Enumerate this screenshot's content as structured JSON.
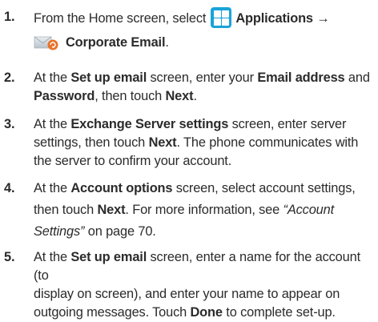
{
  "steps": [
    {
      "num": "1.",
      "t1": "From the Home screen, select",
      "b1": "Applications",
      "arrow": "→",
      "b2": "Corporate Email",
      "t2": "."
    },
    {
      "num": "2.",
      "t1": "At the ",
      "b1": "Set up email",
      "t2": " screen, enter your ",
      "b2": "Email address",
      "t3": " and",
      "b3": "Password",
      "t4": ", then touch ",
      "b4": "Next",
      "t5": "."
    },
    {
      "num": "3.",
      "t1": "At the ",
      "b1": "Exchange Server settings",
      "t2": " screen, enter server",
      "t3": "settings, then touch ",
      "b2": "Next",
      "t4": ". The phone communicates with",
      "t5": "the server to confirm your account."
    },
    {
      "num": "4.",
      "t1": "At the ",
      "b1": "Account options",
      "t2": " screen, select account settings,",
      "t3": "then touch ",
      "b2": "Next",
      "t4": ". For more information, see ",
      "em1": "“Account",
      "em2": "Settings”",
      "t5": " on page 70."
    },
    {
      "num": "5.",
      "t1": "At the ",
      "b1": "Set up email",
      "t2": " screen, enter a name for the account (to",
      "t3": "display on screen), and enter your name to appear on",
      "t4": "outgoing messages. Touch ",
      "b2": "Done",
      "t5": " to complete set-up."
    }
  ],
  "icons": {
    "applications": "applications-icon",
    "corporate_email": "corporate-email-icon"
  },
  "colors": {
    "text": "#2b2b2b",
    "apps_icon_bg": "#19a3d9",
    "email_envelope": "#c8d0d6",
    "email_badge": "#e8732a"
  }
}
